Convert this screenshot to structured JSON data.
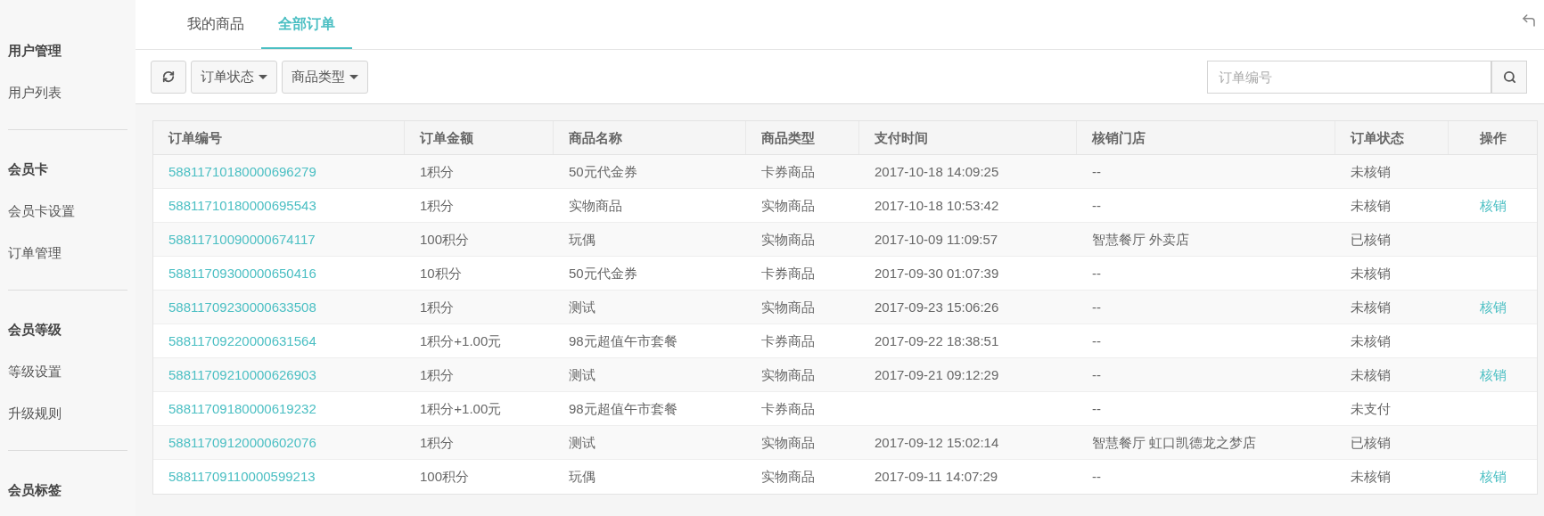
{
  "sidebar": {
    "groups": [
      {
        "heading": "用户管理",
        "items": [
          "用户列表"
        ]
      },
      {
        "heading": "会员卡",
        "items": [
          "会员卡设置",
          "订单管理"
        ]
      },
      {
        "heading": "会员等级",
        "items": [
          "等级设置",
          "升级规则"
        ]
      },
      {
        "heading": "会员标签"
      }
    ]
  },
  "tabs": [
    {
      "label": "我的商品",
      "selected": false
    },
    {
      "label": "全部订单",
      "selected": true
    }
  ],
  "toolbar": {
    "filters": [
      "订单状态",
      "商品类型"
    ],
    "search": {
      "placeholder": "订单编号"
    }
  },
  "table": {
    "columns": [
      "订单编号",
      "订单金额",
      "商品名称",
      "商品类型",
      "支付时间",
      "核销门店",
      "订单状态",
      "操作"
    ],
    "rows": [
      {
        "order_no": "58811710180000696279",
        "amount": "1积分",
        "product": "50元代金券",
        "type": "卡券商品",
        "paid_at": "2017-10-18 14:09:25",
        "store": "--",
        "status": "未核销"
      },
      {
        "order_no": "58811710180000695543",
        "amount": "1积分",
        "product": "实物商品",
        "type": "实物商品",
        "paid_at": "2017-10-18 10:53:42",
        "store": "--",
        "status": "未核销",
        "action": "核销"
      },
      {
        "order_no": "58811710090000674117",
        "amount": "100积分",
        "product": "玩偶",
        "type": "实物商品",
        "paid_at": "2017-10-09 11:09:57",
        "store": "智慧餐厅 外卖店",
        "status": "已核销"
      },
      {
        "order_no": "58811709300000650416",
        "amount": "10积分",
        "product": "50元代金券",
        "type": "卡券商品",
        "paid_at": "2017-09-30 01:07:39",
        "store": "--",
        "status": "未核销"
      },
      {
        "order_no": "58811709230000633508",
        "amount": "1积分",
        "product": "测试",
        "type": "实物商品",
        "paid_at": "2017-09-23 15:06:26",
        "store": "--",
        "status": "未核销",
        "action": "核销"
      },
      {
        "order_no": "58811709220000631564",
        "amount": "1积分+1.00元",
        "product": "98元超值午市套餐",
        "type": "卡券商品",
        "paid_at": "2017-09-22 18:38:51",
        "store": "--",
        "status": "未核销"
      },
      {
        "order_no": "58811709210000626903",
        "amount": "1积分",
        "product": "测试",
        "type": "实物商品",
        "paid_at": "2017-09-21 09:12:29",
        "store": "--",
        "status": "未核销",
        "action": "核销"
      },
      {
        "order_no": "58811709180000619232",
        "amount": "1积分+1.00元",
        "product": "98元超值午市套餐",
        "type": "卡券商品",
        "store": "--",
        "status": "未支付"
      },
      {
        "order_no": "58811709120000602076",
        "amount": "1积分",
        "product": "测试",
        "type": "实物商品",
        "paid_at": "2017-09-12 15:02:14",
        "store": "智慧餐厅 虹口凯德龙之梦店",
        "status": "已核销"
      },
      {
        "order_no": "58811709110000599213",
        "amount": "100积分",
        "product": "玩偶",
        "type": "实物商品",
        "paid_at": "2017-09-11 14:07:29",
        "store": "--",
        "status": "未核销",
        "action": "核销"
      }
    ]
  }
}
